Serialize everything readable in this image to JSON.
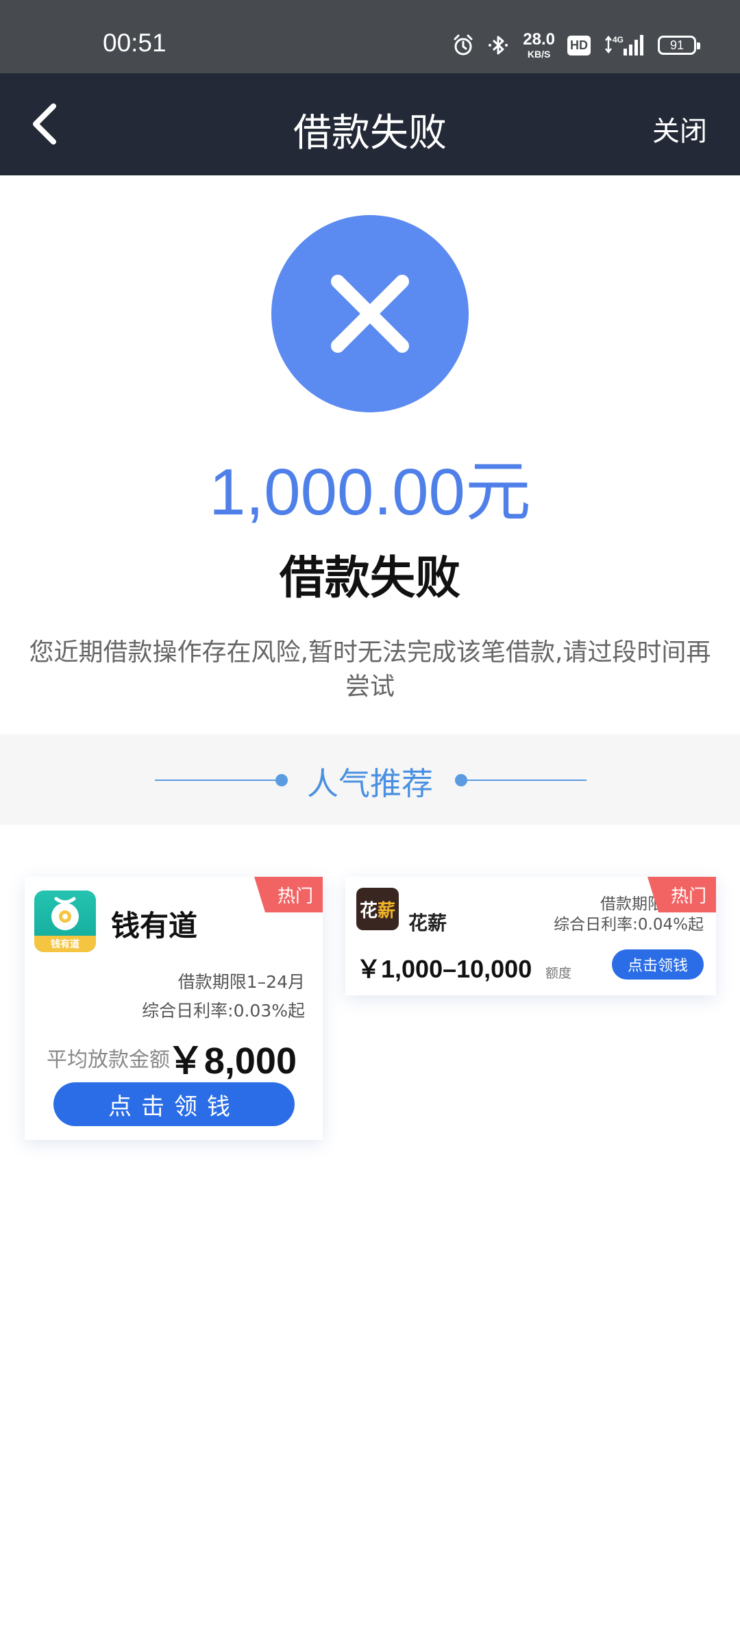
{
  "status_bar": {
    "time": "00:51",
    "net_speed_value": "28.0",
    "net_speed_unit": "KB/S",
    "hd_label": "HD",
    "network_label": "4G",
    "battery_level": "91",
    "icons": [
      "alarm-icon",
      "bluetooth-icon",
      "hd-icon",
      "signal-icon",
      "battery-icon"
    ]
  },
  "nav": {
    "back_icon": "chevron-left-icon",
    "title": "借款失败",
    "close_label": "关闭"
  },
  "result": {
    "icon": "close-x-icon",
    "amount": "1,000.00元",
    "title": "借款失败",
    "description": "您近期借款操作存在风险,暂时无法完成该笔借款,请过段时间再尝试"
  },
  "section": {
    "title": "人气推荐"
  },
  "cards": [
    {
      "tag": "热门",
      "logo_text": "钱有道",
      "name": "钱有道",
      "term": "借款期限1–24月",
      "rate": "综合日利率:0.03%起",
      "avg_label": "平均放款金额",
      "amount": "￥8,000",
      "button": "点击领钱"
    },
    {
      "tag": "热门",
      "logo_text_1": "花",
      "logo_text_2": "薪",
      "name": "花薪",
      "term": "借款期限",
      "rate": "综合日利率:0.04%起",
      "range": "￥1,000–10,000",
      "unit": "额度",
      "button": "点击领钱"
    }
  ],
  "colors": {
    "status_bar_bg": "#474b50",
    "nav_bg": "#232936",
    "accent_blue": "#5b8af0",
    "button_blue": "#2a6de6",
    "hot_red": "#f26464",
    "section_blue": "#4a90e2"
  }
}
